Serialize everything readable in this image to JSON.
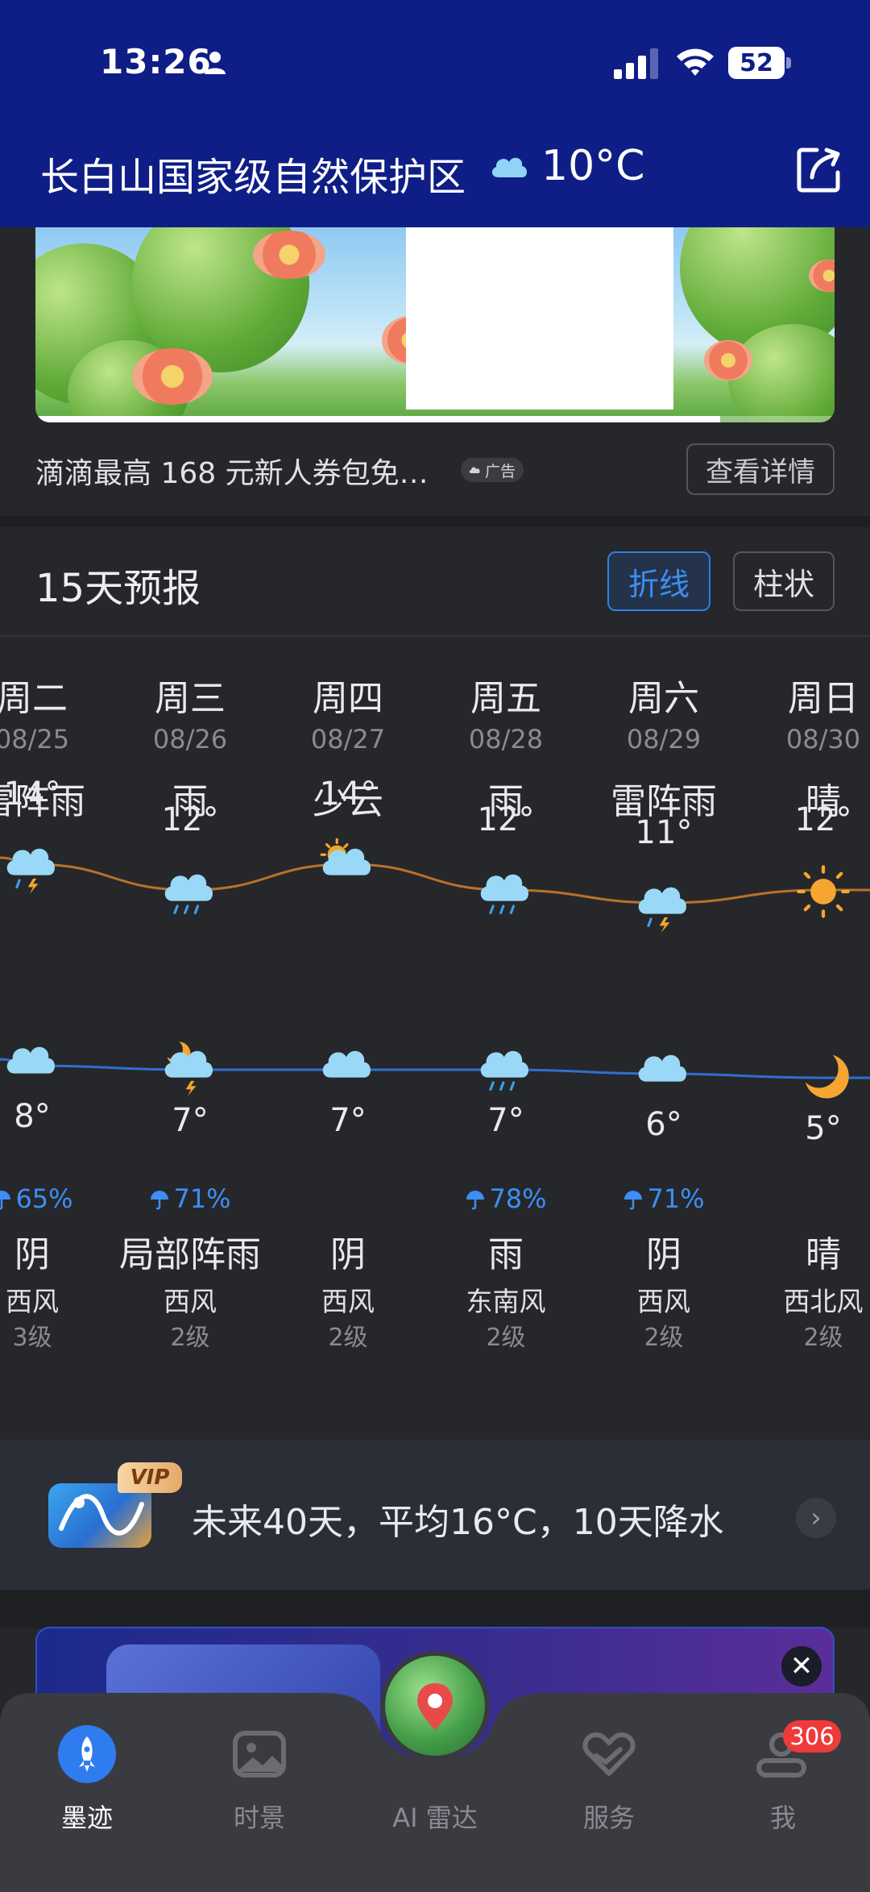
{
  "status_bar": {
    "time": "13:26",
    "battery": "52"
  },
  "header": {
    "location": "长白山国家级自然保护区",
    "temperature": "10°C"
  },
  "ad": {
    "text": "滴滴最高 168 元新人券包免…",
    "tag": "广告",
    "detail_button": "查看详情"
  },
  "forecast": {
    "title": "15天预报",
    "toggle_line": "折线",
    "toggle_bar": "柱状",
    "days": [
      {
        "name": "周二",
        "date": "08/25",
        "cond": "雷阵雨",
        "high": "14°",
        "low": "8°",
        "prob": "65%",
        "night": "阴",
        "wind": "西风",
        "level": "3级",
        "day_icon": "thunder-rain-icon",
        "night_icon": "cloud-icon"
      },
      {
        "name": "周三",
        "date": "08/26",
        "cond": "雨",
        "high": "12°",
        "low": "7°",
        "prob": "71%",
        "night": "局部阵雨",
        "wind": "西风",
        "level": "2级",
        "day_icon": "rain-icon",
        "night_icon": "night-thunder-icon"
      },
      {
        "name": "周四",
        "date": "08/27",
        "cond": "少云",
        "high": "14°",
        "low": "7°",
        "prob": "",
        "night": "阴",
        "wind": "西风",
        "level": "2级",
        "day_icon": "partly-cloudy-icon",
        "night_icon": "cloud-icon"
      },
      {
        "name": "周五",
        "date": "08/28",
        "cond": "雨",
        "high": "12°",
        "low": "7°",
        "prob": "78%",
        "night": "雨",
        "wind": "东南风",
        "level": "2级",
        "day_icon": "rain-icon",
        "night_icon": "rain-icon"
      },
      {
        "name": "周六",
        "date": "08/29",
        "cond": "雷阵雨",
        "high": "11°",
        "low": "6°",
        "prob": "71%",
        "night": "阴",
        "wind": "西风",
        "level": "2级",
        "day_icon": "thunder-rain-icon",
        "night_icon": "cloud-icon"
      },
      {
        "name": "周日",
        "date": "08/30",
        "cond": "晴",
        "high": "12°",
        "low": "5°",
        "prob": "",
        "night": "晴",
        "wind": "西北风",
        "level": "2级",
        "day_icon": "sun-icon",
        "night_icon": "moon-icon"
      }
    ],
    "colors": {
      "high_line": "#b8722a",
      "low_line": "#2f6fd0",
      "prob": "#3d8ef5"
    }
  },
  "vip": {
    "badge": "VIP",
    "text": "未来40天，平均16°C，10天降水"
  },
  "tabs": [
    {
      "label": "墨迹",
      "icon": "rocket-icon",
      "active": true
    },
    {
      "label": "时景",
      "icon": "photo-icon",
      "active": false
    },
    {
      "label": "AI 雷达",
      "icon": "radar-icon",
      "active": false
    },
    {
      "label": "服务",
      "icon": "heart-hand-icon",
      "active": false
    },
    {
      "label": "我",
      "icon": "profile-icon",
      "active": false,
      "badge": "306"
    }
  ]
}
